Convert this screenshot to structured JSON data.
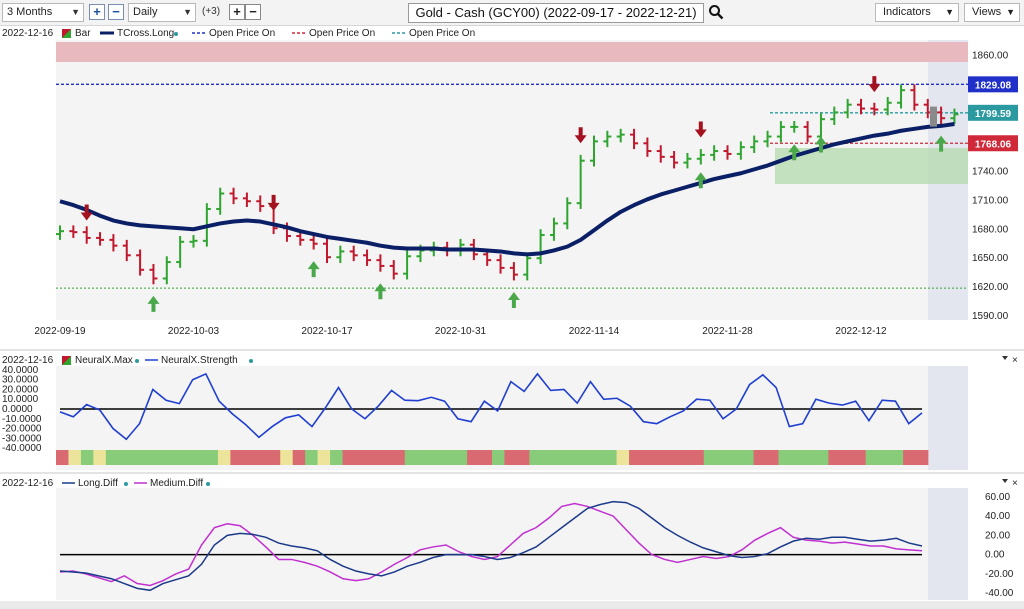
{
  "toolbar": {
    "period": "3 Months",
    "interval": "Daily",
    "count_badge": "(+3)",
    "title": "Gold - Cash (GCY00) (2022-09-17 - 2022-12-21)",
    "indicators_label": "Indicators",
    "views_label": "Views"
  },
  "colors": {
    "up": "#2ea52e",
    "down": "#c0182c",
    "tcross": "#0a1f66",
    "open_blue": "#2030c8",
    "open_red": "#d0293a",
    "open_teal": "#2a9aa0",
    "neural_line": "#1f3fd0",
    "long_diff": "#1b3a8a",
    "medium_diff": "#c030d0"
  },
  "chart_data": [
    {
      "type": "candlestick",
      "panel": "price",
      "legend_date": "2022-12-16",
      "legend": [
        "Bar",
        "TCross.Long",
        "Open Price On",
        "Open Price On",
        "Open Price On"
      ],
      "y_ticks": [
        "1860.00",
        "1829.08",
        "1799.59",
        "1768.06",
        "1740.00",
        "1710.00",
        "1680.00",
        "1650.00",
        "1620.00",
        "1590.00"
      ],
      "ylim": [
        1585,
        1875
      ],
      "x_ticks": [
        {
          "i": 0,
          "label": "2022-09-19"
        },
        {
          "i": 10,
          "label": "2022-10-03"
        },
        {
          "i": 20,
          "label": "2022-10-17"
        },
        {
          "i": 30,
          "label": "2022-10-31"
        },
        {
          "i": 40,
          "label": "2022-11-14"
        },
        {
          "i": 50,
          "label": "2022-11-28"
        },
        {
          "i": 60,
          "label": "2022-12-12"
        }
      ],
      "levels": {
        "blue": 1829.08,
        "teal": 1799.59,
        "red": 1768.06,
        "green_low": 1618
      },
      "tags": [
        {
          "value": 1829.08,
          "label": "1829.08",
          "color": "#2030c8"
        },
        {
          "value": 1799.59,
          "label": "1799.59",
          "color": "#2a9aa0"
        },
        {
          "value": 1768.06,
          "label": "1768.06",
          "color": "#d0293a"
        }
      ],
      "close": [
        1677,
        1676,
        1670,
        1668,
        1662,
        1652,
        1637,
        1628,
        1645,
        1666,
        1667,
        1700,
        1716,
        1711,
        1708,
        1703,
        1680,
        1672,
        1668,
        1664,
        1650,
        1656,
        1652,
        1647,
        1641,
        1633,
        1651,
        1657,
        1660,
        1657,
        1663,
        1653,
        1647,
        1639,
        1632,
        1649,
        1673,
        1685,
        1706,
        1750,
        1770,
        1775,
        1777,
        1768,
        1760,
        1754,
        1748,
        1752,
        1756,
        1760,
        1757,
        1764,
        1770,
        1775,
        1785,
        1785,
        1775,
        1793,
        1800,
        1808,
        1804,
        1803,
        1810,
        1823,
        1808,
        1800,
        1794,
        1798
      ],
      "tcross": [
        1708,
        1704,
        1699,
        1693,
        1688,
        1685,
        1683,
        1682,
        1681,
        1680,
        1679,
        1682,
        1685,
        1687,
        1688,
        1687,
        1684,
        1681,
        1677,
        1674,
        1671,
        1669,
        1667,
        1665,
        1662,
        1660,
        1659,
        1659,
        1659,
        1658,
        1658,
        1658,
        1657,
        1656,
        1654,
        1653,
        1654,
        1657,
        1661,
        1668,
        1678,
        1688,
        1697,
        1704,
        1710,
        1715,
        1719,
        1723,
        1727,
        1731,
        1734,
        1737,
        1741,
        1745,
        1750,
        1755,
        1759,
        1763,
        1767,
        1770,
        1773,
        1776,
        1778,
        1781,
        1783,
        1785,
        1786,
        1788
      ],
      "signals": {
        "down": [
          2,
          16,
          39,
          48,
          61,
          73
        ],
        "up": [
          7,
          19,
          24,
          34,
          48,
          55,
          57,
          66
        ]
      }
    },
    {
      "type": "line_bar",
      "panel": "neural",
      "legend_date": "2022-12-16",
      "legend": [
        "NeuralX.Max",
        "NeuralX.Strength"
      ],
      "y_ticks": [
        "40.0000",
        "30.0000",
        "20.0000",
        "10.0000",
        "0.0000",
        "-10.0000",
        "-20.0000",
        "-30.0000",
        "-40.0000"
      ],
      "ylim": [
        -42000,
        42000
      ],
      "strength": [
        -3000,
        -8000,
        4500,
        -1000,
        -20000,
        -31000,
        -15000,
        20000,
        9000,
        5500,
        30000,
        36000,
        8000,
        -5000,
        -16000,
        -29000,
        -18000,
        -9000,
        -6000,
        -18000,
        1000,
        22000,
        0,
        -10000,
        3000,
        19000,
        9000,
        8500,
        12000,
        8000,
        -10000,
        -13000,
        8000,
        -2000,
        28000,
        18000,
        36000,
        19000,
        20000,
        6000,
        28000,
        10000,
        11000,
        3000,
        -13000,
        -15000,
        -8000,
        -2000,
        10000,
        9000,
        -10000,
        0,
        25000,
        35000,
        22000,
        -18000,
        -15000,
        10000,
        6000,
        4000,
        8000,
        -12000,
        9000,
        8000,
        -15000,
        -4000
      ],
      "max_bands": [
        "r",
        "y",
        "g",
        "y",
        "g",
        "g",
        "g",
        "g",
        "g",
        "g",
        "g",
        "g",
        "g",
        "y",
        "r",
        "r",
        "r",
        "r",
        "y",
        "r",
        "g",
        "y",
        "g",
        "r",
        "r",
        "r",
        "r",
        "r",
        "g",
        "g",
        "g",
        "g",
        "g",
        "r",
        "r",
        "g",
        "r",
        "r",
        "g",
        "g",
        "g",
        "g",
        "g",
        "g",
        "g",
        "y",
        "r",
        "r",
        "r",
        "r",
        "r",
        "r",
        "g",
        "g",
        "g",
        "g",
        "r",
        "r",
        "g",
        "g",
        "g",
        "g",
        "r",
        "r",
        "r",
        "g",
        "g",
        "g",
        "r",
        "r"
      ]
    },
    {
      "type": "line",
      "panel": "diff",
      "legend_date": "2022-12-16",
      "legend": [
        "Long.Diff",
        "Medium.Diff"
      ],
      "y_ticks": [
        "60.00",
        "40.00",
        "20.00",
        "0.00",
        "-20.00",
        "-40.00"
      ],
      "ylim": [
        -45,
        65
      ],
      "long_diff": [
        -17,
        -18,
        -19,
        -22,
        -25,
        -30,
        -35,
        -37,
        -30,
        -26,
        -22,
        -10,
        10,
        20,
        22,
        21,
        18,
        12,
        9,
        7,
        4,
        -5,
        -12,
        -17,
        -20,
        -22,
        -18,
        -12,
        -8,
        -3,
        0,
        0,
        0,
        -2,
        -5,
        -3,
        2,
        8,
        18,
        28,
        38,
        48,
        52,
        55,
        54,
        48,
        38,
        28,
        20,
        13,
        7,
        3,
        -1,
        -3,
        -2,
        1,
        8,
        14,
        17,
        16,
        18,
        18,
        16,
        14,
        15,
        17,
        12,
        9
      ],
      "medium_diff": [
        -18,
        -17,
        -20,
        -24,
        -28,
        -22,
        -30,
        -32,
        -27,
        -20,
        -15,
        10,
        28,
        32,
        30,
        20,
        8,
        -5,
        -5,
        -8,
        -12,
        -18,
        -25,
        -27,
        -25,
        -18,
        -10,
        -3,
        5,
        8,
        10,
        3,
        -2,
        -5,
        -2,
        10,
        22,
        28,
        38,
        50,
        53,
        50,
        45,
        40,
        26,
        12,
        0,
        -5,
        -8,
        -5,
        -2,
        -4,
        -2,
        5,
        15,
        22,
        28,
        18,
        15,
        14,
        12,
        13,
        11,
        9,
        9,
        6,
        5,
        4
      ]
    }
  ]
}
